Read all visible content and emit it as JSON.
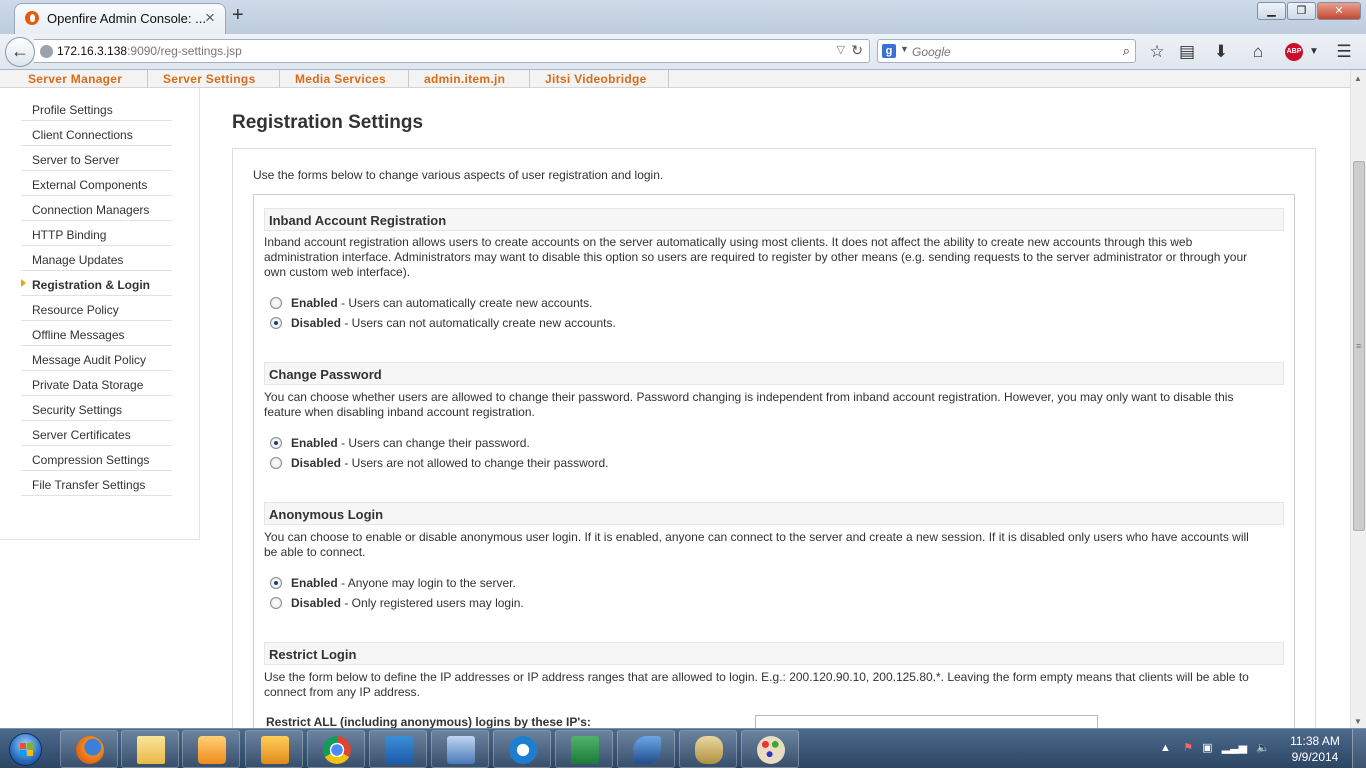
{
  "browser": {
    "tab_title": "Openfire Admin Console: ...",
    "url_host": "172.16.3.138",
    "url_rest": ":9090/reg-settings.jsp",
    "search_placeholder": "Google"
  },
  "topnav": [
    "Server Manager",
    "Server Settings",
    "Media Services",
    "admin.item.jn",
    "Jitsi Videobridge"
  ],
  "sidebar": [
    "Profile Settings",
    "Client Connections",
    "Server to Server",
    "External Components",
    "Connection Managers",
    "HTTP Binding",
    "Manage Updates",
    "Registration & Login",
    "Resource Policy",
    "Offline Messages",
    "Message Audit Policy",
    "Private Data Storage",
    "Security Settings",
    "Server Certificates",
    "Compression Settings",
    "File Transfer Settings"
  ],
  "page": {
    "title": "Registration Settings",
    "intro": "Use the forms below to change various aspects of user registration and login."
  },
  "sections": [
    {
      "title": "Inband Account Registration",
      "desc1": "Inband account registration allows users to create accounts on the server automatically using most clients. It does not affect the ability to create new accounts through this web",
      "desc2": "administration interface. Administrators may want to disable this option so users are required to register by other means (e.g. sending requests to the server administrator or through your",
      "desc3": "own custom web interface).",
      "opt1_bold": "Enabled",
      "opt1_rest": " - Users can automatically create new accounts.",
      "opt2_bold": "Disabled",
      "opt2_rest": " - Users can not automatically create new accounts."
    },
    {
      "title": "Change Password",
      "desc1": "You can choose whether users are allowed to change their password. Password changing is independent from inband account registration. However, you may only want to disable this",
      "desc2": "feature when disabling inband account registration.",
      "opt1_bold": "Enabled",
      "opt1_rest": " - Users can change their password.",
      "opt2_bold": "Disabled",
      "opt2_rest": " - Users are not allowed to change their password."
    },
    {
      "title": "Anonymous Login",
      "desc1": "You can choose to enable or disable anonymous user login. If it is enabled, anyone can connect to the server and create a new session. If it is disabled only users who have accounts will",
      "desc2": "be able to connect.",
      "opt1_bold": "Enabled",
      "opt1_rest": " - Anyone may login to the server.",
      "opt2_bold": "Disabled",
      "opt2_rest": " - Only registered users may login."
    },
    {
      "title": "Restrict Login",
      "desc1": "Use the form below to define the IP addresses or IP address ranges that are allowed to login. E.g.: 200.120.90.10, 200.125.80.*. Leaving the form empty means that clients will be able to",
      "desc2": "connect from any IP address.",
      "field_label": "Restrict ALL (including anonymous) logins by these IP's:"
    }
  ],
  "taskbar": {
    "time": "11:38 AM",
    "date": "9/9/2014"
  }
}
